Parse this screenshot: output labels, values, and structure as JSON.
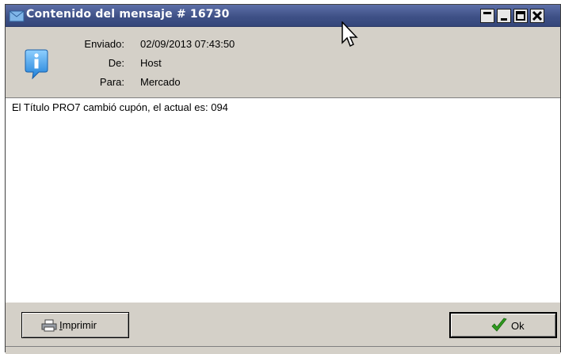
{
  "window": {
    "title": "Contenido del mensaje # 16730"
  },
  "header": {
    "sent_label": "Enviado:",
    "sent_value": "02/09/2013 07:43:50",
    "from_label": "De:",
    "from_value": "Host",
    "to_label": "Para:",
    "to_value": "Mercado"
  },
  "message": {
    "text": "El Título  PRO7  cambió cupón, el actual es: 094"
  },
  "buttons": {
    "print_prefix": "I",
    "print_rest": "mprimir",
    "ok_label": "Ok"
  },
  "colors": {
    "titlebar": "#3f5187",
    "window_bg": "#d4d0c8",
    "ok_check": "#2e9a1e"
  }
}
